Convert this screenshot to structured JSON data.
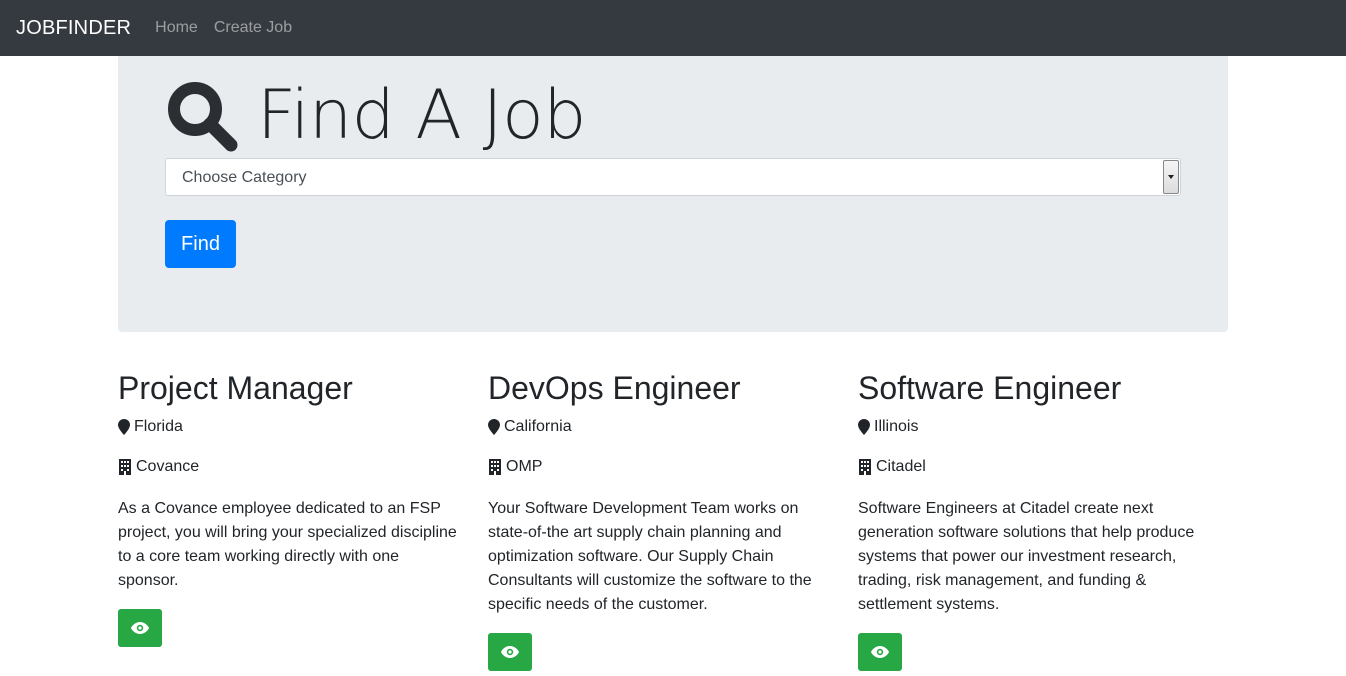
{
  "nav": {
    "brand": "JOBFINDER",
    "links": [
      "Home",
      "Create Job"
    ]
  },
  "hero": {
    "title": "Find A Job",
    "icon": "search-icon",
    "select_value": "Choose Category",
    "find_label": "Find"
  },
  "jobs": [
    {
      "title": "Project Manager",
      "location": "Florida",
      "company": "Covance",
      "description": "As a Covance employee dedicated to an FSP project, you will bring your specialized discipline to a core team working directly with one sponsor."
    },
    {
      "title": "DevOps Engineer",
      "location": "California",
      "company": "OMP",
      "description": "Your Software Development Team works on state-of-the art supply chain planning and optimization software. Our Supply Chain Consultants will customize the software to the specific needs of the customer."
    },
    {
      "title": "Software Engineer",
      "location": "Illinois",
      "company": "Citadel",
      "description": "Software Engineers at Citadel create next generation software solutions that help produce systems that power our investment research, trading, risk management, and funding & settlement systems."
    }
  ],
  "colors": {
    "navbar": "#343a40",
    "jumbotron": "#e9ecef",
    "primary": "#007bff",
    "success": "#28a745"
  }
}
